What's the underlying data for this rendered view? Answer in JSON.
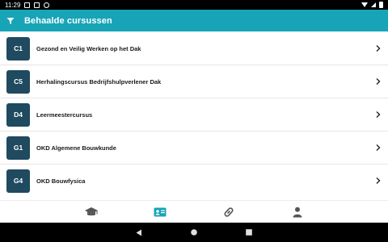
{
  "status_bar": {
    "time": "11:29"
  },
  "app_bar": {
    "title": "Behaalde cursussen"
  },
  "courses": [
    {
      "code": "C1",
      "name": "Gezond en Veilig Werken op het Dak"
    },
    {
      "code": "C5",
      "name": "Herhalingscursus Bedrijfshulpverlener Dak"
    },
    {
      "code": "D4",
      "name": "Leermeestercursus"
    },
    {
      "code": "G1",
      "name": "OKD Algemene Bouwkunde"
    },
    {
      "code": "G4",
      "name": "OKD Bouwfysica"
    }
  ],
  "bottom_nav": [
    {
      "icon": "graduation-cap-icon"
    },
    {
      "icon": "id-card-icon",
      "active": true
    },
    {
      "icon": "link-icon"
    },
    {
      "icon": "person-icon"
    }
  ],
  "colors": {
    "primary": "#17a4b7",
    "badge": "#1f4a5f",
    "active_nav": "#17a4b7",
    "inactive_nav": "#555555"
  }
}
